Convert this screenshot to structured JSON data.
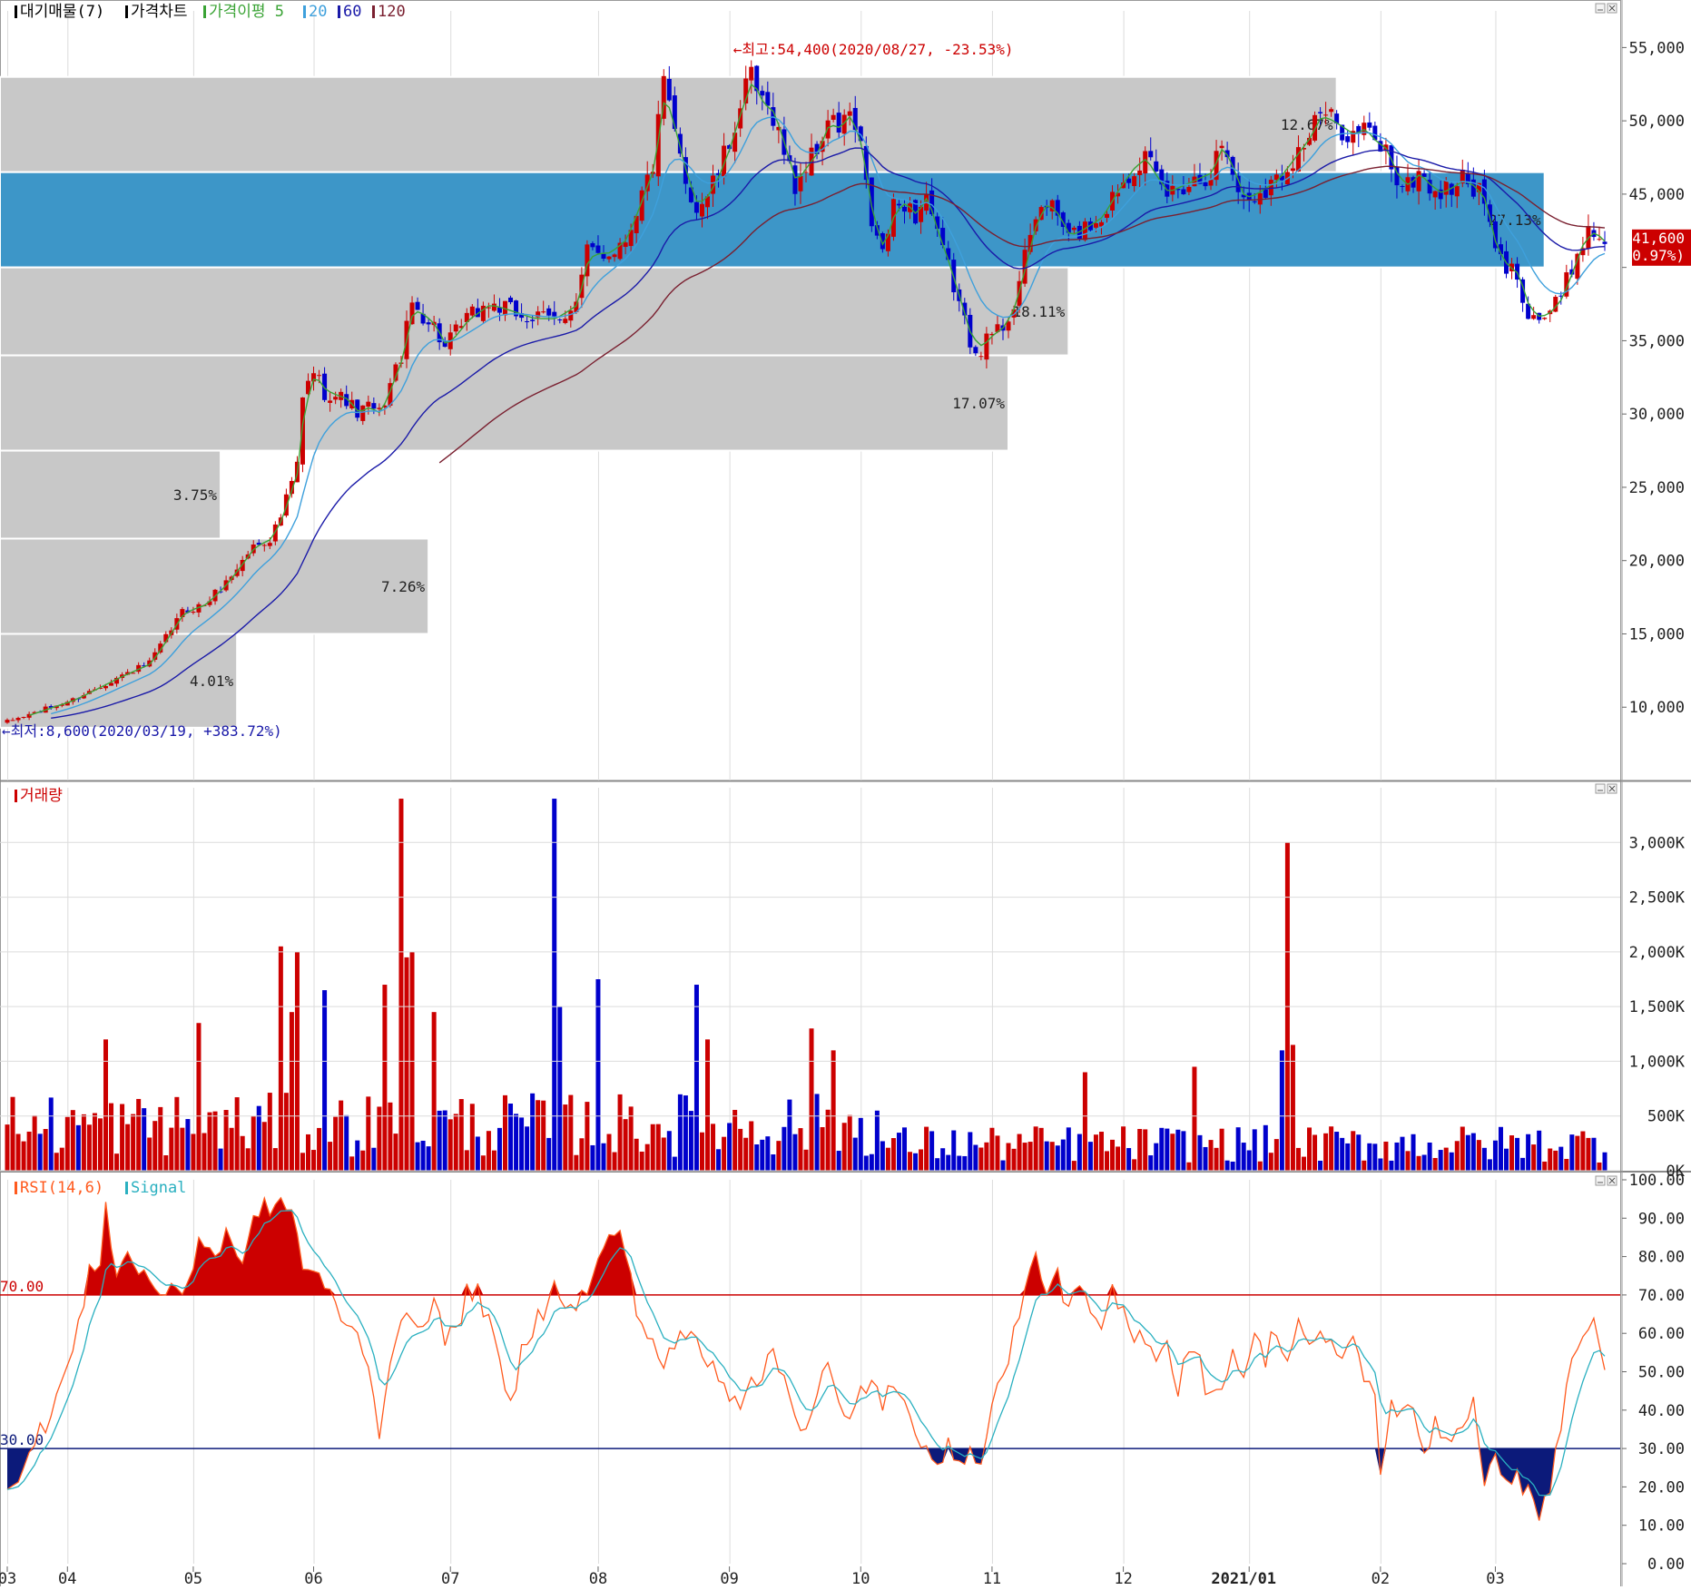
{
  "colors": {
    "up": "#cc0000",
    "down": "#0000cc",
    "zone": "#c8c8c8",
    "zone_hi": "#3d96c8",
    "ma5": "#3aa335",
    "ma20": "#3ea0dc",
    "ma60": "#1a1aa8",
    "ma120": "#7a2030",
    "rsi": "#ff5a1e",
    "signal": "#2ab0c0",
    "grid": "#dcdcdc"
  },
  "icons": [
    "minimize-icon",
    "close-icon"
  ],
  "chart_data": [
    {
      "type": "candlestick",
      "panel": "price",
      "legend": [
        {
          "label": "대기매물(7)",
          "color": "#000000"
        },
        {
          "label": "가격차트",
          "color": "#000000"
        },
        {
          "label": "가격이평 5",
          "color": "#3aa335"
        },
        {
          "label": "20",
          "color": "#3ea0dc"
        },
        {
          "label": "60",
          "color": "#1a1aa8"
        },
        {
          "label": "120",
          "color": "#7a2030"
        }
      ],
      "ylim": [
        5000,
        57500
      ],
      "y_ticks": [
        55000,
        50000,
        45000,
        40000,
        35000,
        30000,
        25000,
        20000,
        15000,
        10000
      ],
      "y_tick_labels": [
        "55,000",
        "50,000",
        "45,000",
        "",
        "35,000",
        "30,000",
        "25,000",
        "20,000",
        "15,000",
        "10,000"
      ],
      "high_annotation": "←최고:54,400(2020/08/27, -23.53%)",
      "low_annotation": "←최저:8,600(2020/03/19, +383.72%)",
      "last_price": {
        "value": 41600,
        "label": "41,600",
        "change": "(0.97%)"
      },
      "price_path": [
        [
          0,
          9000
        ],
        [
          12,
          10500
        ],
        [
          20,
          12000
        ],
        [
          26,
          13000
        ],
        [
          32,
          16500
        ],
        [
          36,
          17000
        ],
        [
          40,
          18500
        ],
        [
          45,
          21000
        ],
        [
          48,
          21500
        ],
        [
          50,
          23000
        ],
        [
          53,
          26500
        ],
        [
          54,
          31000
        ],
        [
          56,
          33000
        ],
        [
          58,
          31500
        ],
        [
          62,
          31000
        ],
        [
          64,
          30000
        ],
        [
          66,
          30500
        ],
        [
          68,
          30000
        ],
        [
          72,
          34000
        ],
        [
          74,
          37500
        ],
        [
          78,
          36000
        ],
        [
          80,
          34500
        ],
        [
          84,
          36500
        ],
        [
          88,
          37500
        ],
        [
          92,
          37000
        ],
        [
          96,
          36500
        ],
        [
          100,
          36500
        ],
        [
          104,
          37500
        ],
        [
          106,
          41000
        ],
        [
          110,
          41000
        ],
        [
          113,
          42000
        ],
        [
          116,
          45000
        ],
        [
          118,
          47000
        ],
        [
          120,
          52500
        ],
        [
          122,
          49000
        ],
        [
          124,
          46000
        ],
        [
          126,
          44000
        ],
        [
          128,
          45000
        ],
        [
          130,
          46500
        ],
        [
          132,
          48500
        ],
        [
          134,
          51000
        ],
        [
          136,
          53000
        ],
        [
          138,
          51000
        ],
        [
          140,
          50500
        ],
        [
          142,
          48000
        ],
        [
          144,
          45500
        ],
        [
          146,
          47000
        ],
        [
          148,
          48000
        ],
        [
          150,
          50000
        ],
        [
          152,
          49500
        ],
        [
          154,
          50500
        ],
        [
          156,
          48000
        ],
        [
          158,
          43000
        ],
        [
          160,
          41000
        ],
        [
          162,
          44000
        ],
        [
          164,
          44500
        ],
        [
          166,
          43500
        ],
        [
          168,
          45000
        ],
        [
          170,
          42000
        ],
        [
          172,
          40000
        ],
        [
          174,
          37500
        ],
        [
          176,
          35000
        ],
        [
          178,
          34500
        ],
        [
          180,
          35500
        ],
        [
          182,
          36000
        ],
        [
          184,
          37500
        ],
        [
          186,
          40500
        ],
        [
          188,
          43500
        ],
        [
          190,
          44500
        ],
        [
          192,
          43500
        ],
        [
          194,
          42000
        ],
        [
          196,
          42500
        ],
        [
          198,
          43000
        ],
        [
          200,
          43500
        ],
        [
          203,
          45500
        ],
        [
          206,
          47000
        ],
        [
          208,
          47500
        ],
        [
          210,
          46000
        ],
        [
          212,
          45000
        ],
        [
          214,
          45500
        ],
        [
          217,
          46000
        ],
        [
          220,
          46500
        ],
        [
          222,
          48500
        ],
        [
          224,
          46500
        ],
        [
          226,
          44500
        ],
        [
          228,
          45000
        ],
        [
          230,
          45500
        ],
        [
          232,
          46000
        ],
        [
          234,
          47000
        ],
        [
          236,
          48000
        ],
        [
          238,
          49000
        ],
        [
          240,
          50500
        ],
        [
          242,
          50000
        ],
        [
          244,
          49500
        ],
        [
          246,
          49000
        ],
        [
          248,
          49500
        ],
        [
          250,
          48500
        ],
        [
          252,
          48000
        ],
        [
          254,
          46000
        ],
        [
          256,
          45500
        ],
        [
          258,
          46500
        ],
        [
          260,
          45500
        ],
        [
          262,
          45000
        ],
        [
          264,
          45500
        ],
        [
          266,
          46000
        ],
        [
          268,
          45500
        ],
        [
          270,
          44500
        ],
        [
          272,
          41000
        ],
        [
          274,
          40000
        ],
        [
          276,
          39500
        ],
        [
          278,
          37000
        ],
        [
          280,
          36500
        ],
        [
          282,
          37000
        ],
        [
          284,
          38000
        ],
        [
          286,
          40000
        ],
        [
          288,
          42000
        ],
        [
          290,
          42500
        ],
        [
          292,
          41600
        ]
      ],
      "moving_averages": [
        {
          "name": "5",
          "color": "#3aa335",
          "start": 4,
          "lag": 2
        },
        {
          "name": "20",
          "color": "#3ea0dc",
          "start": 8,
          "lag": 10
        },
        {
          "name": "60",
          "color": "#1a1aa8",
          "start": 8,
          "lag": 30
        },
        {
          "name": "120",
          "color": "#7a2030",
          "start": 79,
          "lag": 55
        }
      ],
      "supply_zones": [
        {
          "low": 46500,
          "high": 53000,
          "x_end": 243,
          "label": "12.67%",
          "highlight": false
        },
        {
          "low": 40000,
          "high": 46500,
          "x_end": 281,
          "label": "27.13%",
          "highlight": true
        },
        {
          "low": 34000,
          "high": 40000,
          "x_end": 194,
          "label": "18.11%",
          "highlight": false
        },
        {
          "low": 27500,
          "high": 34000,
          "x_end": 183,
          "label": "17.07%",
          "highlight": false
        },
        {
          "low": 21500,
          "high": 27500,
          "x_end": 39,
          "label": "3.75%",
          "highlight": false
        },
        {
          "low": 15000,
          "high": 21500,
          "x_end": 77,
          "label": "7.26%",
          "highlight": false
        },
        {
          "low": 8600,
          "high": 15000,
          "x_end": 42,
          "label": "4.01%",
          "highlight": false
        }
      ],
      "x_axis": {
        "n_bars": 293,
        "labels": [
          {
            "i": 0,
            "label": "03"
          },
          {
            "i": 11,
            "label": "04"
          },
          {
            "i": 34,
            "label": "05"
          },
          {
            "i": 56,
            "label": "06"
          },
          {
            "i": 81,
            "label": "07"
          },
          {
            "i": 108,
            "label": "08"
          },
          {
            "i": 132,
            "label": "09"
          },
          {
            "i": 156,
            "label": "10"
          },
          {
            "i": 180,
            "label": "11"
          },
          {
            "i": 204,
            "label": "12"
          },
          {
            "i": 227,
            "label": "2021/01"
          },
          {
            "i": 251,
            "label": "02"
          },
          {
            "i": 272,
            "label": "03"
          }
        ]
      }
    },
    {
      "type": "bar",
      "panel": "volume",
      "legend": [
        {
          "label": "거래량",
          "color": "#cc0000"
        }
      ],
      "ylim": [
        0,
        3500000
      ],
      "y_ticks": [
        3000000,
        2500000,
        2000000,
        1500000,
        1000000,
        500000,
        0
      ],
      "y_tick_labels": [
        "3,000K",
        "2,500K",
        "2,000K",
        "1,500K",
        "1,000K",
        "500K",
        "0K"
      ],
      "baseline": 350000,
      "spikes": [
        {
          "i": 18,
          "v": 1200000
        },
        {
          "i": 35,
          "v": 1350000
        },
        {
          "i": 50,
          "v": 2050000
        },
        {
          "i": 52,
          "v": 1450000
        },
        {
          "i": 53,
          "v": 2000000
        },
        {
          "i": 58,
          "v": 1650000
        },
        {
          "i": 69,
          "v": 1700000
        },
        {
          "i": 72,
          "v": 3400000
        },
        {
          "i": 73,
          "v": 1950000
        },
        {
          "i": 74,
          "v": 2000000
        },
        {
          "i": 78,
          "v": 1450000
        },
        {
          "i": 100,
          "v": 3400000
        },
        {
          "i": 101,
          "v": 1500000
        },
        {
          "i": 108,
          "v": 1750000
        },
        {
          "i": 126,
          "v": 1700000
        },
        {
          "i": 128,
          "v": 1200000
        },
        {
          "i": 147,
          "v": 1300000
        },
        {
          "i": 151,
          "v": 1100000
        },
        {
          "i": 197,
          "v": 900000
        },
        {
          "i": 217,
          "v": 950000
        },
        {
          "i": 233,
          "v": 1100000
        },
        {
          "i": 234,
          "v": 3000000
        },
        {
          "i": 235,
          "v": 1150000
        }
      ]
    },
    {
      "type": "line",
      "panel": "rsi",
      "legend": [
        {
          "label": "RSI(14,6)",
          "color": "#ff5a1e"
        },
        {
          "label": "Signal",
          "color": "#2ab0c0"
        }
      ],
      "ylim": [
        0,
        100
      ],
      "y_ticks": [
        100,
        90,
        80,
        70,
        60,
        50,
        40,
        30,
        20,
        10,
        0
      ],
      "y_tick_labels": [
        "100.00",
        "90.00",
        "80.00",
        "70.00",
        "60.00",
        "50.00",
        "40.00",
        "30.00",
        "20.00",
        "10.00",
        "0.00"
      ],
      "upper": 70,
      "upper_label": "70.00",
      "lower": 30,
      "lower_label": "30.00",
      "rsi_path": [
        [
          0,
          20
        ],
        [
          4,
          28
        ],
        [
          8,
          40
        ],
        [
          12,
          55
        ],
        [
          15,
          75
        ],
        [
          17,
          80
        ],
        [
          18,
          93
        ],
        [
          20,
          76
        ],
        [
          22,
          80
        ],
        [
          24,
          77
        ],
        [
          27,
          72
        ],
        [
          30,
          70
        ],
        [
          33,
          73
        ],
        [
          35,
          85
        ],
        [
          38,
          80
        ],
        [
          40,
          86
        ],
        [
          42,
          78
        ],
        [
          44,
          84
        ],
        [
          46,
          92
        ],
        [
          50,
          94
        ],
        [
          52,
          92
        ],
        [
          54,
          78
        ],
        [
          58,
          72
        ],
        [
          62,
          63
        ],
        [
          66,
          54
        ],
        [
          68,
          33
        ],
        [
          70,
          55
        ],
        [
          73,
          63
        ],
        [
          76,
          64
        ],
        [
          78,
          68
        ],
        [
          80,
          58
        ],
        [
          82,
          61
        ],
        [
          84,
          70
        ],
        [
          86,
          72
        ],
        [
          88,
          62
        ],
        [
          90,
          52
        ],
        [
          92,
          40
        ],
        [
          94,
          55
        ],
        [
          96,
          62
        ],
        [
          98,
          66
        ],
        [
          100,
          76
        ],
        [
          102,
          65
        ],
        [
          104,
          67
        ],
        [
          106,
          72
        ],
        [
          108,
          78
        ],
        [
          110,
          84
        ],
        [
          112,
          88
        ],
        [
          114,
          73
        ],
        [
          116,
          62
        ],
        [
          118,
          58
        ],
        [
          120,
          52
        ],
        [
          122,
          56
        ],
        [
          124,
          60
        ],
        [
          126,
          58
        ],
        [
          128,
          52
        ],
        [
          130,
          50
        ],
        [
          132,
          45
        ],
        [
          134,
          42
        ],
        [
          136,
          50
        ],
        [
          138,
          48
        ],
        [
          140,
          55
        ],
        [
          142,
          48
        ],
        [
          144,
          40
        ],
        [
          146,
          35
        ],
        [
          148,
          45
        ],
        [
          150,
          52
        ],
        [
          152,
          40
        ],
        [
          154,
          36
        ],
        [
          156,
          45
        ],
        [
          158,
          48
        ],
        [
          160,
          42
        ],
        [
          162,
          46
        ],
        [
          164,
          40
        ],
        [
          166,
          34
        ],
        [
          168,
          32
        ],
        [
          170,
          28
        ],
        [
          172,
          30
        ],
        [
          174,
          24
        ],
        [
          176,
          32
        ],
        [
          178,
          26
        ],
        [
          180,
          40
        ],
        [
          182,
          50
        ],
        [
          184,
          60
        ],
        [
          186,
          70
        ],
        [
          188,
          80
        ],
        [
          190,
          72
        ],
        [
          192,
          74
        ],
        [
          194,
          68
        ],
        [
          196,
          70
        ],
        [
          198,
          66
        ],
        [
          200,
          60
        ],
        [
          202,
          70
        ],
        [
          204,
          65
        ],
        [
          206,
          58
        ],
        [
          208,
          60
        ],
        [
          210,
          55
        ],
        [
          212,
          58
        ],
        [
          214,
          45
        ],
        [
          216,
          58
        ],
        [
          218,
          52
        ],
        [
          220,
          42
        ],
        [
          222,
          48
        ],
        [
          224,
          55
        ],
        [
          226,
          50
        ],
        [
          228,
          58
        ],
        [
          230,
          54
        ],
        [
          232,
          62
        ],
        [
          234,
          52
        ],
        [
          236,
          64
        ],
        [
          238,
          56
        ],
        [
          240,
          58
        ],
        [
          242,
          56
        ],
        [
          244,
          55
        ],
        [
          246,
          58
        ],
        [
          248,
          50
        ],
        [
          250,
          42
        ],
        [
          251,
          25
        ],
        [
          253,
          42
        ],
        [
          255,
          38
        ],
        [
          257,
          40
        ],
        [
          259,
          28
        ],
        [
          261,
          38
        ],
        [
          263,
          32
        ],
        [
          265,
          35
        ],
        [
          268,
          42
        ],
        [
          270,
          18
        ],
        [
          272,
          28
        ],
        [
          274,
          24
        ],
        [
          276,
          22
        ],
        [
          278,
          18
        ],
        [
          280,
          14
        ],
        [
          282,
          20
        ],
        [
          284,
          35
        ],
        [
          286,
          55
        ],
        [
          288,
          58
        ],
        [
          290,
          63
        ],
        [
          292,
          53
        ]
      ],
      "signal_window": 6
    }
  ]
}
